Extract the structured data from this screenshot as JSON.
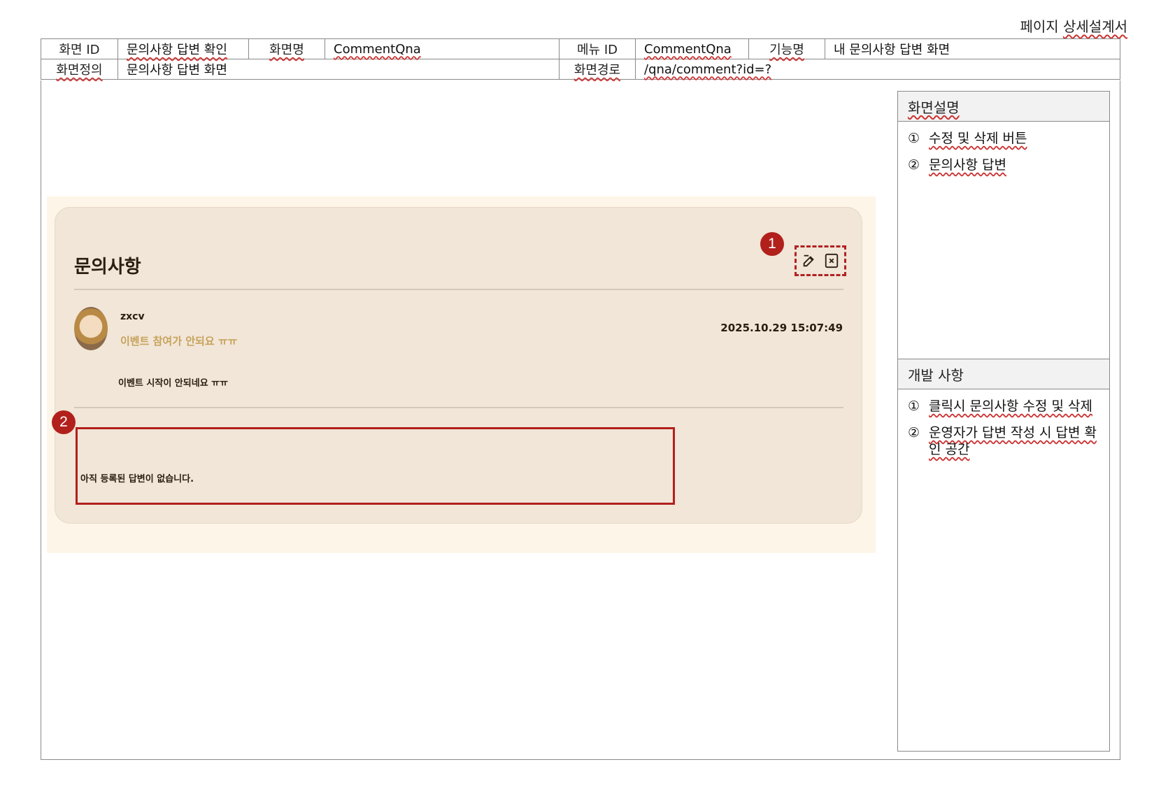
{
  "document": {
    "title": "페이지 상세설계서",
    "title_part1": "페이지 ",
    "title_part2": "상세설계서"
  },
  "meta": {
    "screen_id_label": "화면 ID",
    "screen_id_value": "문의사항 답변 확인",
    "screen_name_label": "화면명",
    "screen_name_value": "CommentQna",
    "menu_id_label": "메뉴 ID",
    "menu_id_value": "CommentQna",
    "function_label": "기능명",
    "function_value": "내 문의사항 답변 화면",
    "definition_label": "화면정의",
    "definition_value": "문의사항 답변 화면",
    "path_label": "화면경로",
    "path_value": "/qna/comment?id=?"
  },
  "mock": {
    "title": "문의사항",
    "username": "zxcv",
    "subject": "이벤트 참여가 안되요 ㅠㅠ",
    "timestamp": "2025.10.29 15:07:49",
    "body": "이벤트 시작이 안되네요 ㅠㅠ",
    "answer_empty": "아직 등록된 답변이 없습니다.",
    "badge1": "1",
    "badge2": "2",
    "edit_icon": "edit-icon",
    "delete_icon": "close-icon"
  },
  "sidebar": {
    "description_title": "화면설명",
    "description_items": [
      {
        "num": "①",
        "text": "수정 및 삭제 버튼"
      },
      {
        "num": "②",
        "text": "문의사항 답변"
      }
    ],
    "dev_title": "개발 사항",
    "dev_items": [
      {
        "num": "①",
        "text": "클릭시 문의사항 수정 및 삭제"
      },
      {
        "num": "②",
        "text": "운영자가 답변 작성 시 답변 확인 공간"
      }
    ]
  },
  "colors": {
    "accent_red": "#b2201c",
    "card_bg": "#f1e6d8",
    "page_bg": "#fdf6e8",
    "subtitle_gold": "#c7a25a"
  }
}
